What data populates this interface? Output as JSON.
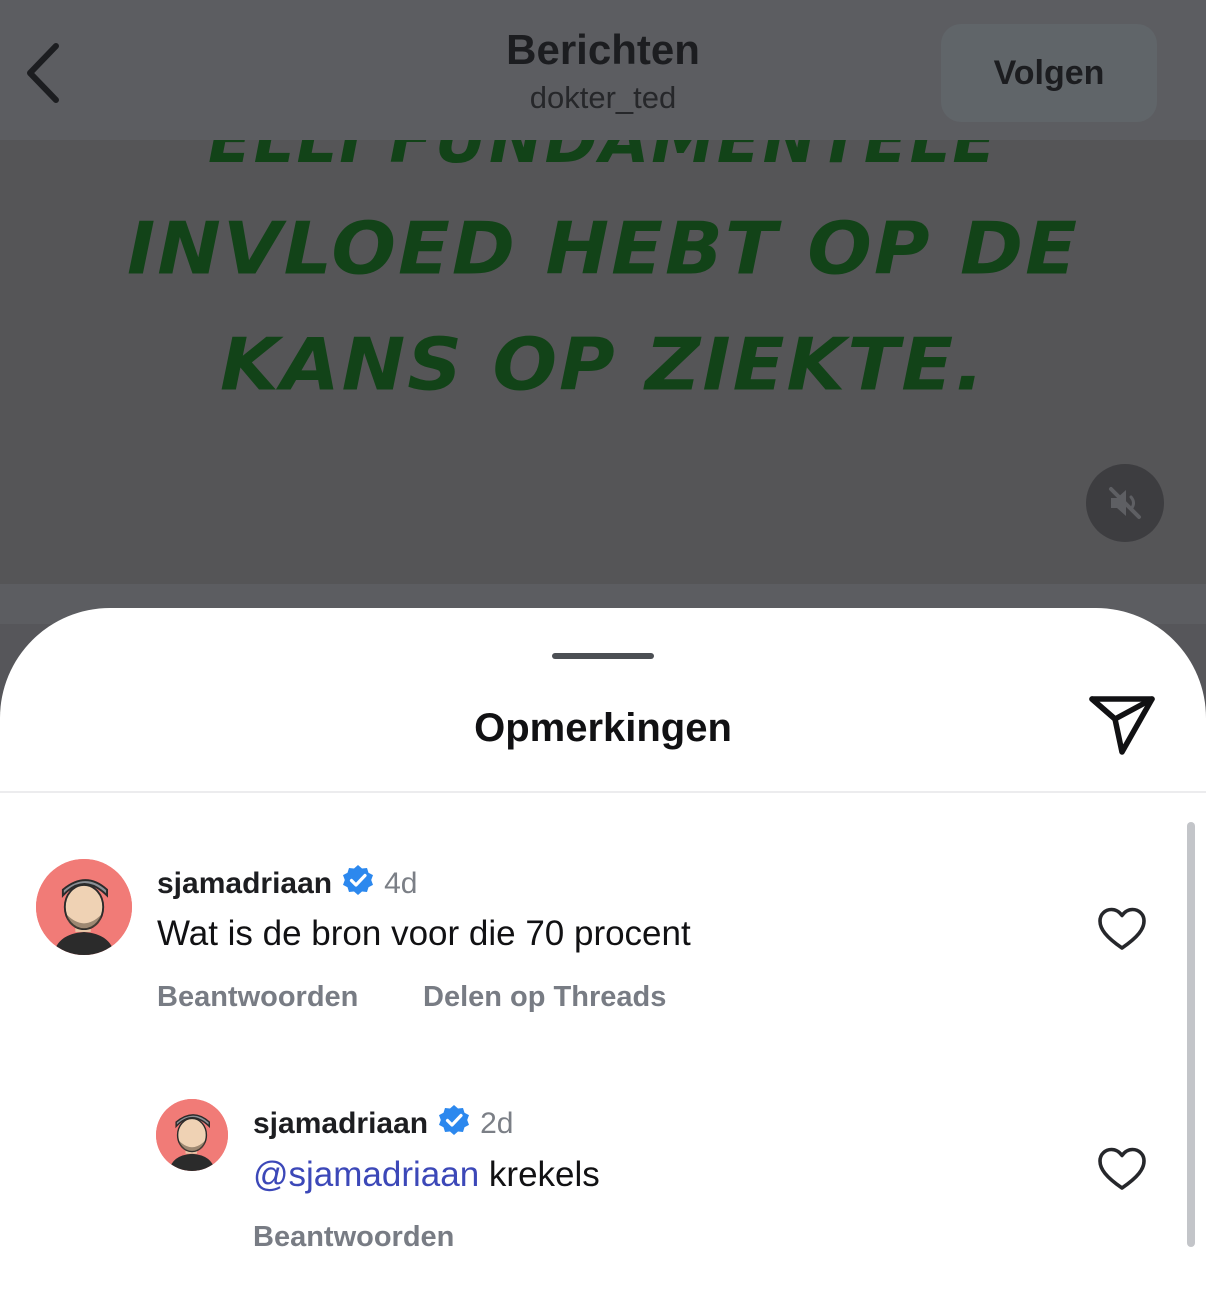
{
  "header": {
    "back_icon": "chevron-left-icon",
    "title": "Berichten",
    "subtitle": "dokter_ted",
    "follow_label": "Volgen"
  },
  "video": {
    "caption_lines": [
      "ELLI FUNDAMENTELE",
      "INVLOED HEBT OP DE",
      "KANS OP ZIEKTE."
    ],
    "caption_color": "#124318",
    "mute_icon": "speaker-muted-icon"
  },
  "comments_sheet": {
    "title": "Opmerkingen",
    "share_icon": "paper-plane-icon",
    "comments": [
      {
        "username": "sjamadriaan",
        "verified": true,
        "time": "4d",
        "text": "Wat is de bron voor die 70 procent",
        "reply_label": "Beantwoorden",
        "share_threads_label": "Delen op Threads",
        "like_icon": "heart-outline-icon"
      }
    ],
    "replies": [
      {
        "username": "sjamadriaan",
        "verified": true,
        "time": "2d",
        "mention": "@sjamadriaan",
        "text": "krekels",
        "reply_label": "Beantwoorden",
        "like_icon": "heart-outline-icon"
      }
    ]
  },
  "colors": {
    "verified_badge": "#2c88ee",
    "mention": "#3c48b8",
    "avatar_bg": "#f17b77"
  }
}
